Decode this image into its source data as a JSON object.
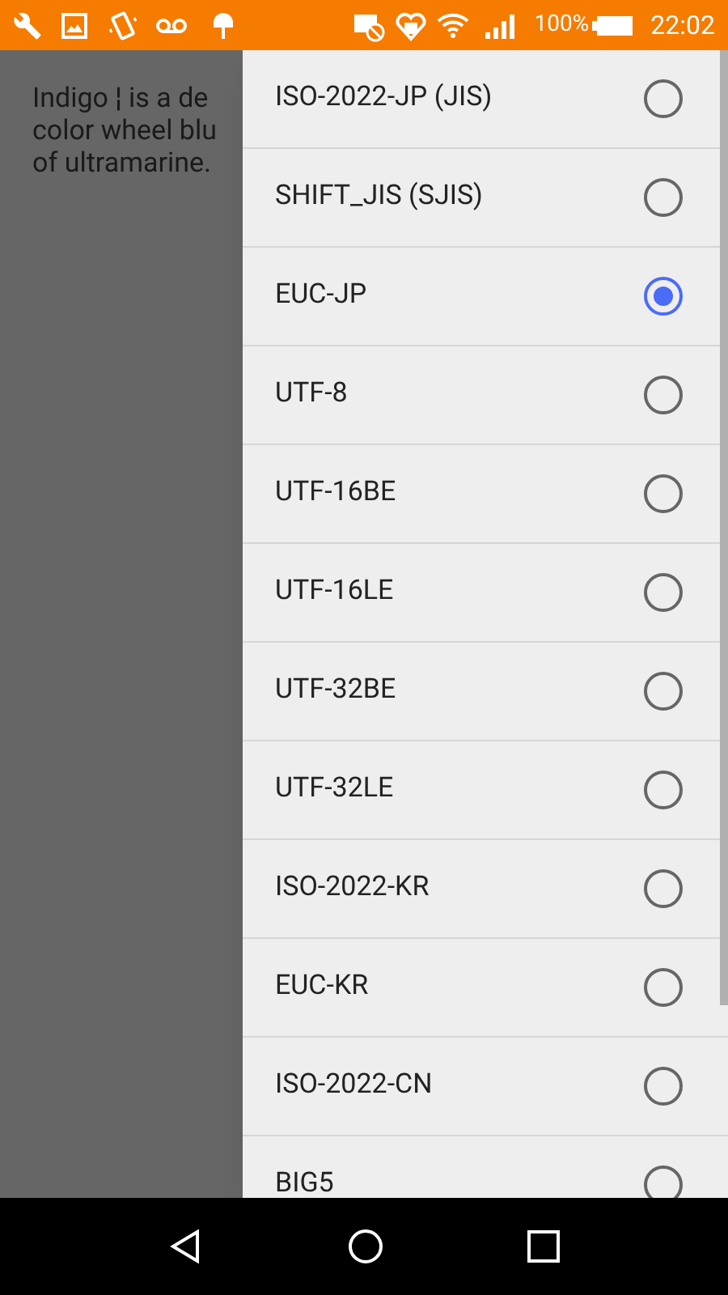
{
  "status_bar": {
    "battery_text": "100%",
    "time": "22:02"
  },
  "page": {
    "lines": [
      "Indigo ¦ is a de",
      "color wheel blu",
      "of ultramarine."
    ]
  },
  "encoding_menu": {
    "items": [
      {
        "label": "ISO-2022-JP (JIS)",
        "selected": false
      },
      {
        "label": "SHIFT_JIS (SJIS)",
        "selected": false
      },
      {
        "label": "EUC-JP",
        "selected": true
      },
      {
        "label": "UTF-8",
        "selected": false
      },
      {
        "label": "UTF-16BE",
        "selected": false
      },
      {
        "label": "UTF-16LE",
        "selected": false
      },
      {
        "label": "UTF-32BE",
        "selected": false
      },
      {
        "label": "UTF-32LE",
        "selected": false
      },
      {
        "label": "ISO-2022-KR",
        "selected": false
      },
      {
        "label": "EUC-KR",
        "selected": false
      },
      {
        "label": "ISO-2022-CN",
        "selected": false
      },
      {
        "label": "BIG5",
        "selected": false
      }
    ]
  }
}
